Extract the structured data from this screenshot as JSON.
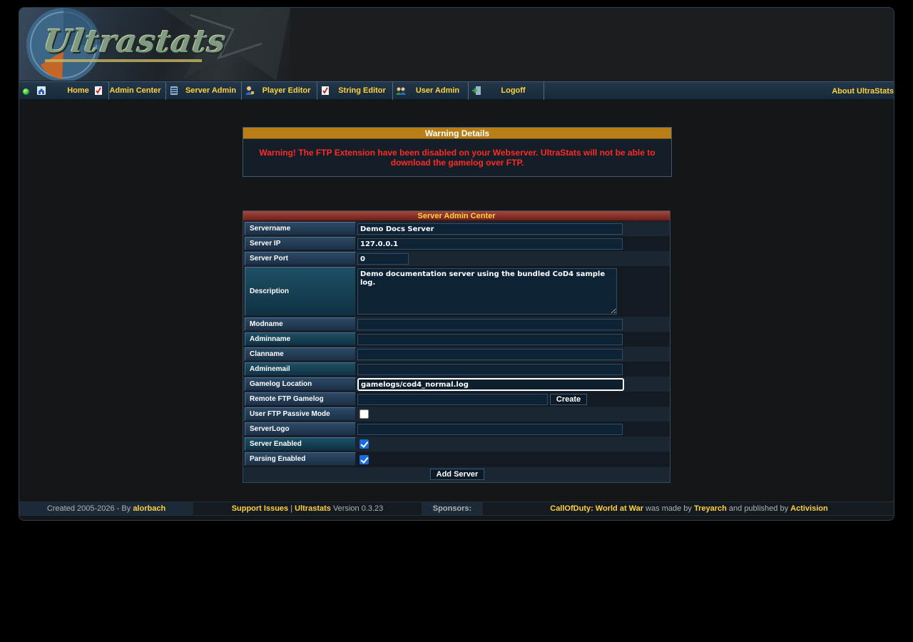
{
  "header": {
    "logo_text": "Ultrastats"
  },
  "nav": {
    "items": [
      {
        "label": "Home",
        "icon": "home-icon"
      },
      {
        "label": "Admin Center",
        "icon": "document-icon"
      },
      {
        "label": "Server Admin",
        "icon": "server-icon"
      },
      {
        "label": "Player Editor",
        "icon": "user-icon"
      },
      {
        "label": "String Editor",
        "icon": "document-icon"
      },
      {
        "label": "User Admin",
        "icon": "users-icon"
      },
      {
        "label": "Logoff",
        "icon": "logout-icon"
      }
    ],
    "about": "About UltraStats"
  },
  "warning": {
    "title": "Warning Details",
    "message": "Warning! The FTP Extension have been disabled on your Webserver. UltraStats will not be able to download the gamelog over FTP."
  },
  "admin": {
    "title": "Server Admin Center",
    "servername": {
      "label": "Servername",
      "value": "Demo Docs Server"
    },
    "server_ip": {
      "label": "Server IP",
      "value": "127.0.0.1"
    },
    "server_port": {
      "label": "Server Port",
      "value": "0"
    },
    "description": {
      "label": "Description",
      "value": "Demo documentation server using the bundled CoD4 sample log."
    },
    "modname": {
      "label": "Modname",
      "value": ""
    },
    "adminname": {
      "label": "Adminname",
      "value": ""
    },
    "clanname": {
      "label": "Clanname",
      "value": ""
    },
    "adminemail": {
      "label": "Adminemail",
      "value": ""
    },
    "gamelog_location": {
      "label": "Gamelog Location",
      "value": "gamelogs/cod4_normal.log"
    },
    "remote_ftp": {
      "label": "Remote FTP Gamelog Location",
      "value": "",
      "button": "Create"
    },
    "ftp_passive": {
      "label": "User FTP Passive Mode",
      "checked": false
    },
    "serverlogo": {
      "label": "ServerLogo",
      "value": ""
    },
    "server_enabled": {
      "label": "Server Enabled",
      "checked": true
    },
    "parsing_enabled": {
      "label": "Parsing Enabled",
      "checked": true
    },
    "submit": "Add Server"
  },
  "footer": {
    "created_prefix": "Created 2005-2026 - By",
    "author": "alorbach",
    "support": "Support Issues",
    "sep": "|",
    "product": "Ultrastats",
    "version": "Version 0.3.23",
    "sponsors": "Sponsors:",
    "game": "CallOfDuty: World at War",
    "made_by_text": "was made by",
    "developer": "Treyarch",
    "published_text": "and published by",
    "publisher": "Activision"
  },
  "colors": {
    "accent": "#ffd23a",
    "warning_text": "#ff2a24",
    "warning_header": "#b77f15",
    "admin_header": "#8a2e26"
  }
}
